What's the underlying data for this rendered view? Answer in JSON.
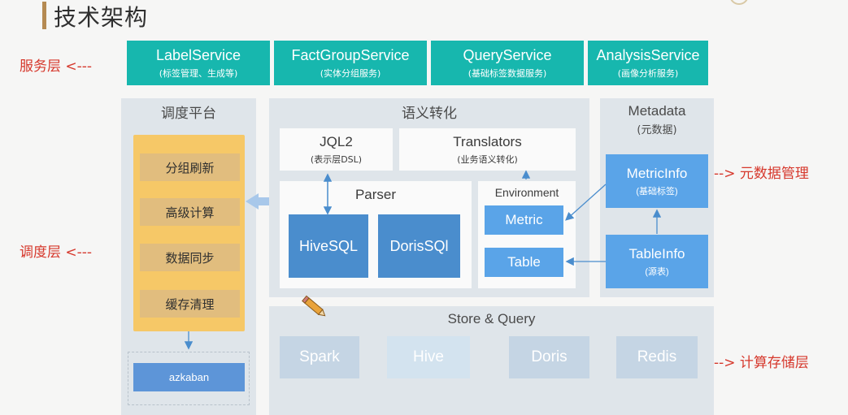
{
  "header": {
    "title": "技术架构"
  },
  "services": [
    {
      "name": "LabelService",
      "sub": "(标签管理、生成等)"
    },
    {
      "name": "FactGroupService",
      "sub": "(实体分组服务)"
    },
    {
      "name": "QueryService",
      "sub": "(基础标签数据服务)"
    },
    {
      "name": "AnalysisService",
      "sub": "(画像分析服务)"
    }
  ],
  "layers": {
    "service": "服务层 <---",
    "schedule": "调度层 <---",
    "metadata": "--> 元数据管理",
    "compute": "--> 计算存储层"
  },
  "scheduler": {
    "title": "调度平台",
    "items": [
      "分组刷新",
      "高级计算",
      "数据同步",
      "缓存清理"
    ],
    "azkaban": "azkaban"
  },
  "semantic": {
    "title": "语义转化",
    "jql": {
      "name": "JQL2",
      "sub": "(表示层DSL)"
    },
    "translators": {
      "name": "Translators",
      "sub": "(业务语义转化)"
    },
    "parser": {
      "title": "Parser",
      "items": [
        "HiveSQL",
        "DorisSQl"
      ]
    },
    "environment": {
      "title": "Environment",
      "items": [
        "Metric",
        "Table"
      ]
    }
  },
  "metadata": {
    "title": "Metadata",
    "sub": "(元数据)",
    "metricinfo": {
      "name": "MetricInfo",
      "sub": "(基础标签)"
    },
    "tableinfo": {
      "name": "TableInfo",
      "sub": "(源表)"
    }
  },
  "store": {
    "title": "Store & Query",
    "items": [
      "Spark",
      "Hive",
      "Doris",
      "Redis"
    ]
  },
  "colors": {
    "service": "#17b7ae",
    "accent_red": "#d6382c",
    "orange": "#f6c867",
    "blue": "#5aa4e8"
  }
}
